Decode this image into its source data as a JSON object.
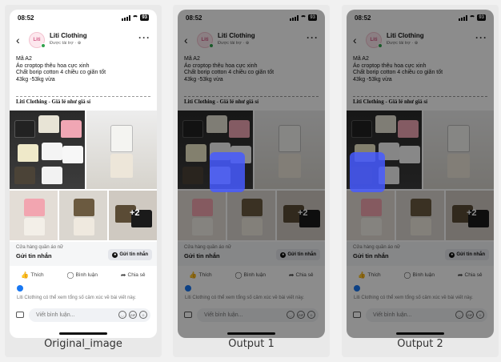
{
  "status": {
    "time": "08:52",
    "battery": "93"
  },
  "header": {
    "page_name": "Liti Clothing",
    "avatar_text": "Liti",
    "subtitle": "Được tài trợ · ⊕"
  },
  "post": {
    "lines": [
      "Mã A2",
      "Áo croptop thêu hoa cực xinh",
      "Chất borip cotton 4 chiều co giãn tốt",
      "43kg -53kg vừa"
    ],
    "banner": "Liti Clothing - Giá lẻ như giá sỉ",
    "more_photos": "+2"
  },
  "cta": {
    "subtitle": "Cửa hàng quần áo nữ",
    "title": "Gửi tin nhắn",
    "button": "Gửi tin nhắn"
  },
  "actions": {
    "like": "Thích",
    "comment": "Bình luận",
    "share": "Chia sẻ"
  },
  "info_text": "Liti Clothing có thể xem tổng số cảm xúc về bài viết này.",
  "comment_bar": {
    "placeholder": "Viết bình luận...",
    "gif": "GIF"
  },
  "captions": {
    "original": "Original_image",
    "output1": "Output 1",
    "output2": "Output 2"
  },
  "colors": {
    "accent": "#1877f2",
    "highlight": "#4a5cff"
  }
}
